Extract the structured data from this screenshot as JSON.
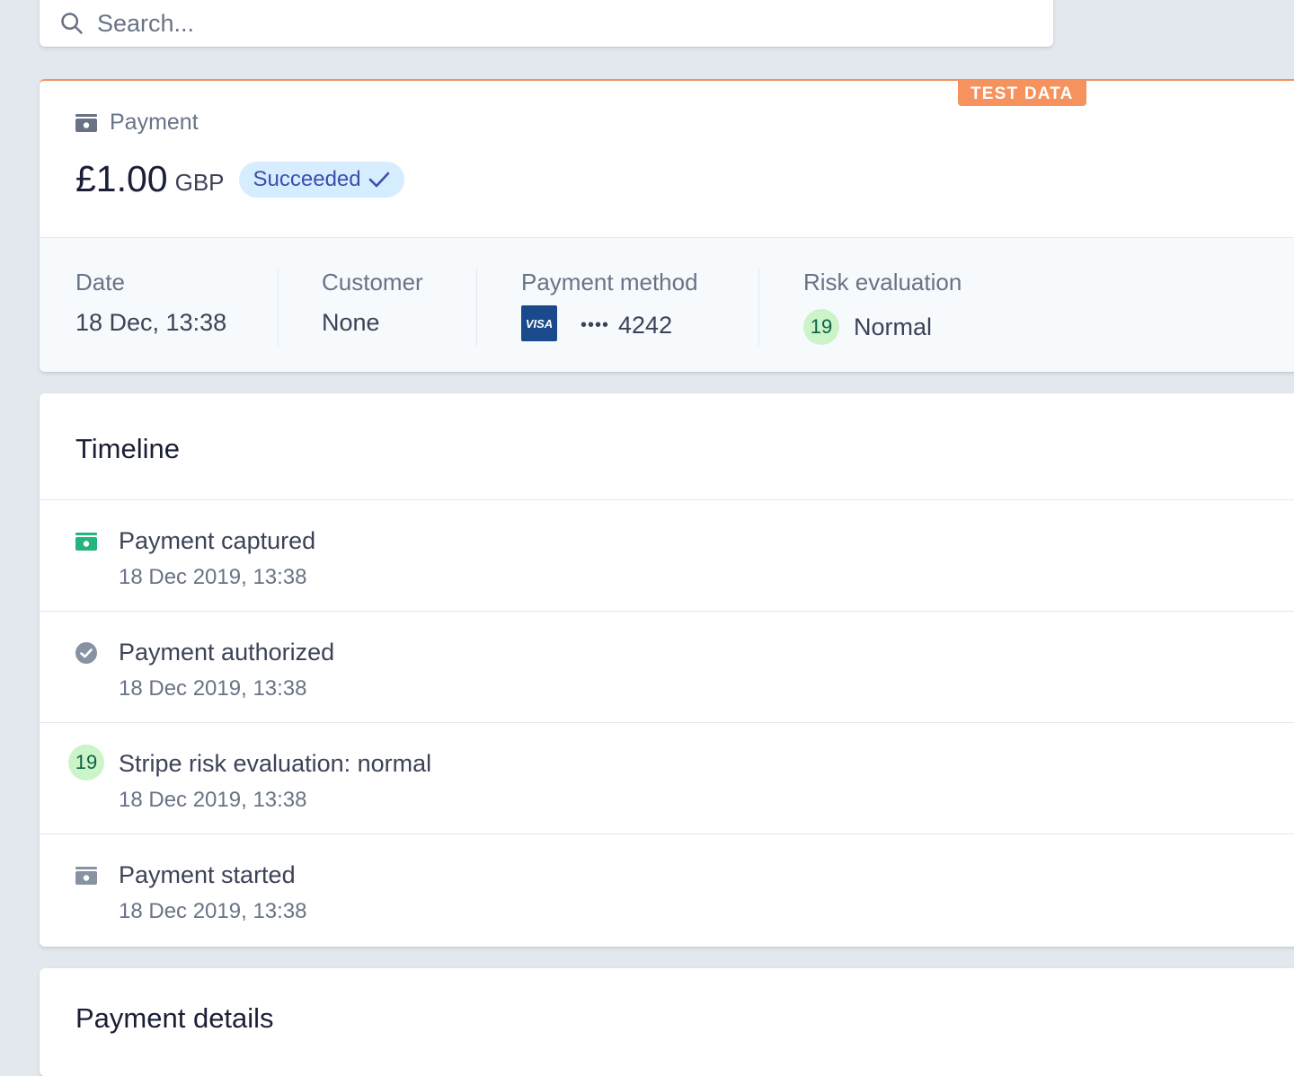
{
  "search": {
    "placeholder": "Search..."
  },
  "payment": {
    "test_badge": "TEST DATA",
    "label": "Payment",
    "amount": "£1.00",
    "currency": "GBP",
    "status": "Succeeded",
    "status_color": "#d6ecff"
  },
  "summary": {
    "date": {
      "label": "Date",
      "value": "18 Dec, 13:38"
    },
    "customer": {
      "label": "Customer",
      "value": "None"
    },
    "payment_method": {
      "label": "Payment method",
      "brand": "VISA",
      "dots": "••••",
      "last4": "4242"
    },
    "risk": {
      "label": "Risk evaluation",
      "score": "19",
      "value": "Normal"
    }
  },
  "timeline": {
    "title": "Timeline",
    "events": [
      {
        "icon": "cash-icon",
        "title": "Payment captured",
        "date": "18 Dec 2019, 13:38"
      },
      {
        "icon": "check-circle-icon",
        "title": "Payment authorized",
        "date": "18 Dec 2019, 13:38"
      },
      {
        "icon": "risk-score-badge",
        "badge": "19",
        "title": "Stripe risk evaluation: normal",
        "date": "18 Dec 2019, 13:38"
      },
      {
        "icon": "cash-icon",
        "title": "Payment started",
        "date": "18 Dec 2019, 13:38"
      }
    ]
  },
  "details": {
    "title": "Payment details"
  },
  "colors": {
    "accent_test": "#f5925e",
    "success_green": "#24b47e",
    "risk_badge_bg": "#cbf4c9",
    "status_text": "#3d4eac"
  }
}
